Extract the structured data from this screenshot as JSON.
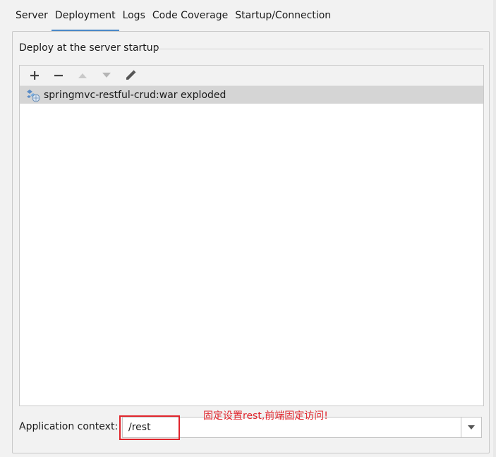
{
  "tabs": [
    {
      "label": "Server",
      "active": false
    },
    {
      "label": "Deployment",
      "active": true
    },
    {
      "label": "Logs",
      "active": false
    },
    {
      "label": "Code Coverage",
      "active": false
    },
    {
      "label": "Startup/Connection",
      "active": false
    }
  ],
  "deploy_group": {
    "title": "Deploy at the server startup",
    "toolbar": {
      "icons": [
        "plus-icon",
        "minus-icon",
        "arrow-up-icon",
        "arrow-down-icon",
        "pencil-icon"
      ]
    },
    "items": [
      {
        "label": "springmvc-restful-crud:war exploded",
        "icon": "artifact-exploded-icon",
        "selected": true
      }
    ]
  },
  "application_context": {
    "label": "Application context:",
    "value": "/rest"
  },
  "annotation": {
    "text": "固定设置rest,前端固定访问!",
    "color": "#e0252c"
  },
  "colors": {
    "active_tab_underline": "#4a88c7",
    "selected_row": "#d5d5d5",
    "background": "#f2f2f2"
  }
}
